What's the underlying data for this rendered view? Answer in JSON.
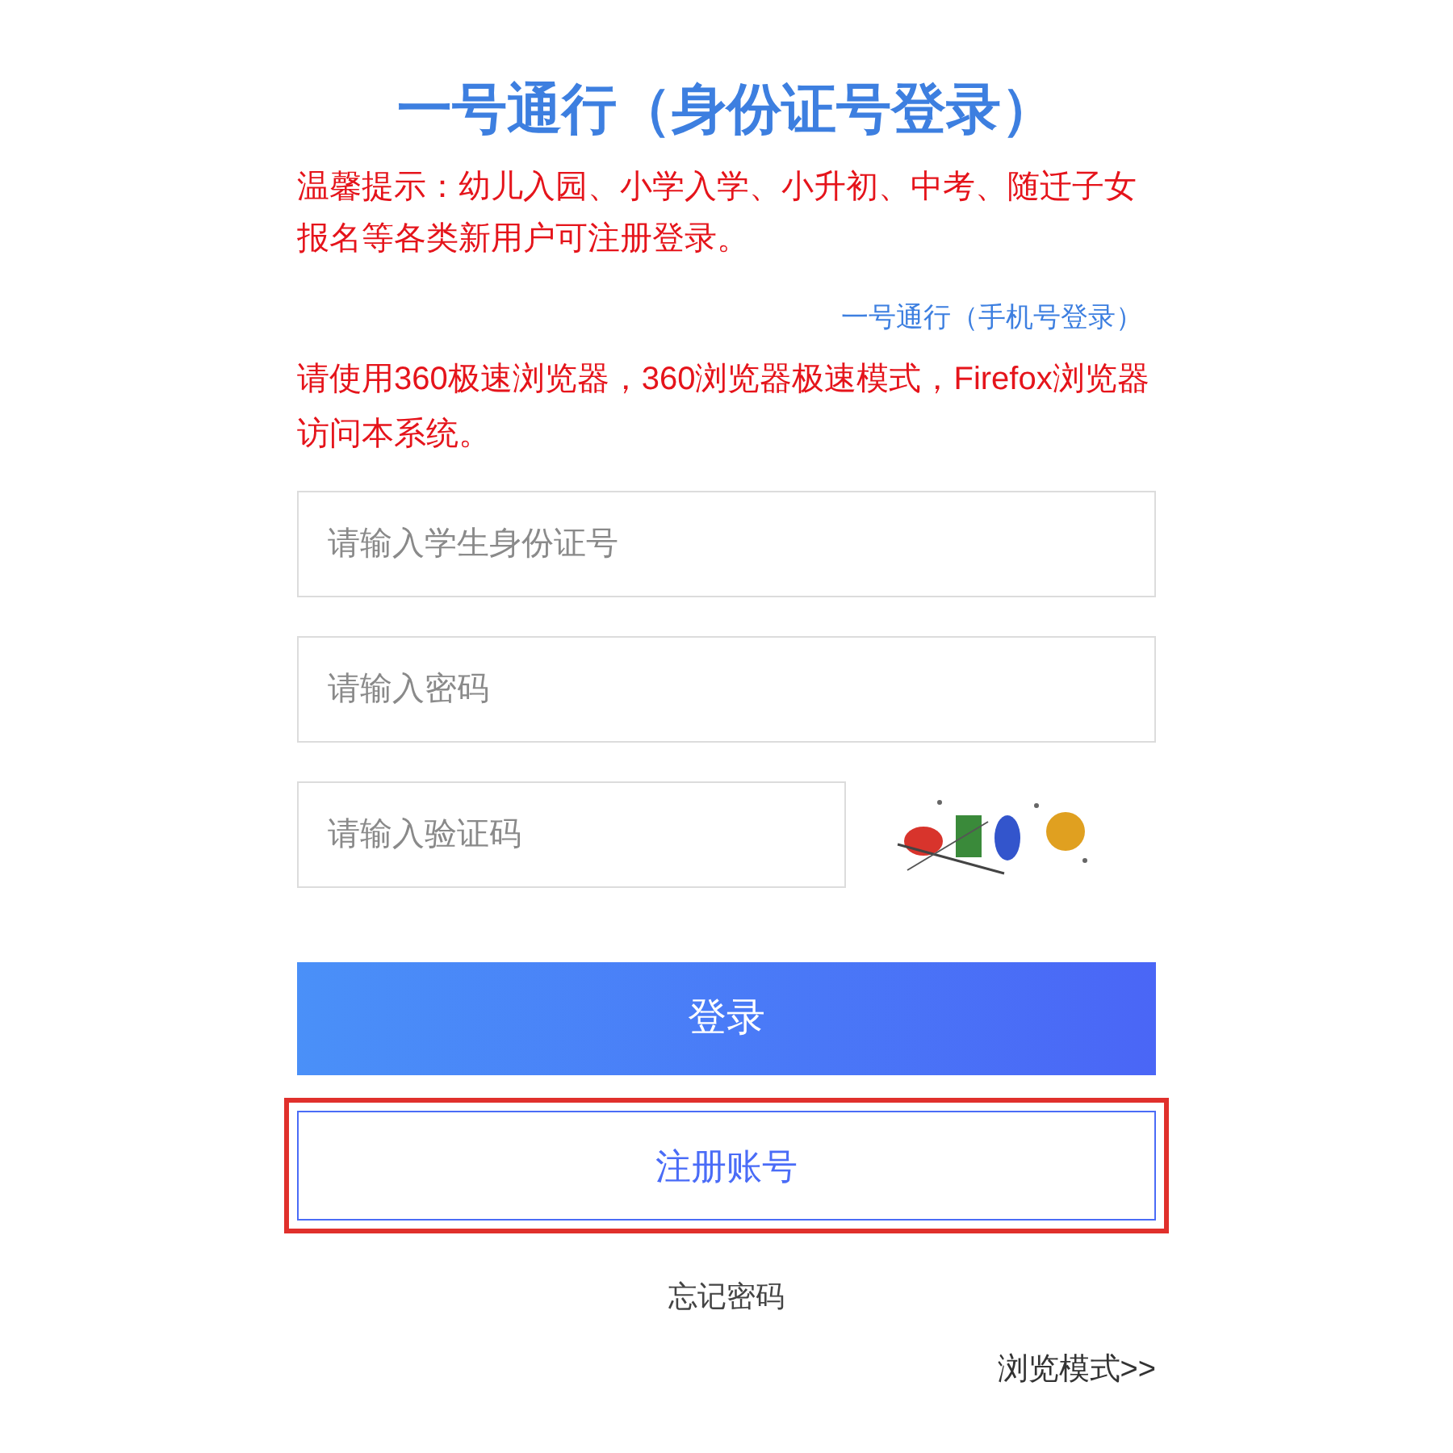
{
  "title": "一号通行（身份证号登录）",
  "notice": "温馨提示：幼儿入园、小学入学、小升初、中考、随迁子女报名等各类新用户可注册登录。",
  "phone_login_link": "一号通行（手机号登录）",
  "browser_notice": "请使用360极速浏览器，360浏览器极速模式，Firefox浏览器访问本系统。",
  "fields": [
    {
      "placeholder": "请输入学生身份证号"
    },
    {
      "placeholder": "请输入密码"
    }
  ],
  "captcha": {
    "placeholder": "请输入验证码"
  },
  "login_button": "登录",
  "register_button": {
    "label": "注册账号",
    "highlighted": true
  },
  "forgot_password": "忘记密码",
  "browse_mode": "浏览模式>>"
}
